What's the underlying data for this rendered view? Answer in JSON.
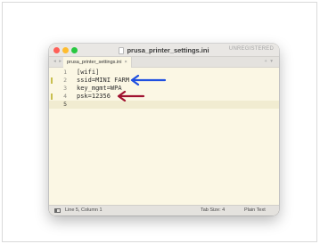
{
  "window": {
    "title": "prusa_printer_settings.ini",
    "registration": "UNREGISTERED"
  },
  "tabs": [
    {
      "label": "prusa_printer_settings.ini",
      "close": "×"
    }
  ],
  "editor": {
    "lines": [
      {
        "number": "1",
        "text": "[wifi]",
        "modified": false
      },
      {
        "number": "2",
        "text": "ssid=MINI FARM",
        "modified": true
      },
      {
        "number": "3",
        "text": "key_mgmt=WPA",
        "modified": false
      },
      {
        "number": "4",
        "text": "psk=12356",
        "modified": true
      },
      {
        "number": "5",
        "text": "",
        "modified": false
      }
    ],
    "current_line": 5
  },
  "annotations": [
    {
      "target_line": 2,
      "color": "#1f4fe0",
      "icon": "arrow-left-icon"
    },
    {
      "target_line": 4,
      "color": "#a01230",
      "icon": "arrow-left-icon"
    }
  ],
  "status": {
    "position": "Line 5, Column 1",
    "tab_size": "Tab Size: 4",
    "syntax": "Plain Text"
  },
  "colors": {
    "editor_background": "#fbf7e4",
    "modified_marker": "#c8bf4f"
  }
}
